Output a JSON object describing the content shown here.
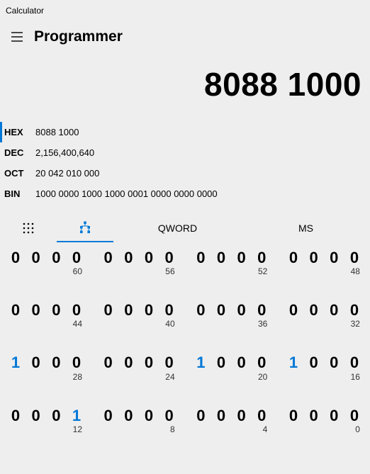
{
  "app_title": "Calculator",
  "mode": "Programmer",
  "display": "8088 1000",
  "bases": [
    {
      "label": "HEX",
      "value": "8088 1000",
      "active": true
    },
    {
      "label": "DEC",
      "value": "2,156,400,640",
      "active": false
    },
    {
      "label": "OCT",
      "value": "20 042 010 000",
      "active": false
    },
    {
      "label": "BIN",
      "value": "1000 0000 1000 1000 0001 0000 0000 0000",
      "active": false
    }
  ],
  "func": {
    "keypad_active": false,
    "bit_active": true,
    "qword": "QWORD",
    "ms": "MS"
  },
  "bits": [
    [
      {
        "bits": [
          "0",
          "0",
          "0",
          "0"
        ],
        "idx": "60"
      },
      {
        "bits": [
          "0",
          "0",
          "0",
          "0"
        ],
        "idx": "56"
      },
      {
        "bits": [
          "0",
          "0",
          "0",
          "0"
        ],
        "idx": "52"
      },
      {
        "bits": [
          "0",
          "0",
          "0",
          "0"
        ],
        "idx": "48"
      }
    ],
    [
      {
        "bits": [
          "0",
          "0",
          "0",
          "0"
        ],
        "idx": "44"
      },
      {
        "bits": [
          "0",
          "0",
          "0",
          "0"
        ],
        "idx": "40"
      },
      {
        "bits": [
          "0",
          "0",
          "0",
          "0"
        ],
        "idx": "36"
      },
      {
        "bits": [
          "0",
          "0",
          "0",
          "0"
        ],
        "idx": "32"
      }
    ],
    [
      {
        "bits": [
          "1",
          "0",
          "0",
          "0"
        ],
        "idx": "28"
      },
      {
        "bits": [
          "0",
          "0",
          "0",
          "0"
        ],
        "idx": "24"
      },
      {
        "bits": [
          "1",
          "0",
          "0",
          "0"
        ],
        "idx": "20"
      },
      {
        "bits": [
          "1",
          "0",
          "0",
          "0"
        ],
        "idx": "16"
      }
    ],
    [
      {
        "bits": [
          "0",
          "0",
          "0",
          "1"
        ],
        "idx": "12"
      },
      {
        "bits": [
          "0",
          "0",
          "0",
          "0"
        ],
        "idx": "8"
      },
      {
        "bits": [
          "0",
          "0",
          "0",
          "0"
        ],
        "idx": "4"
      },
      {
        "bits": [
          "0",
          "0",
          "0",
          "0"
        ],
        "idx": "0"
      }
    ]
  ]
}
